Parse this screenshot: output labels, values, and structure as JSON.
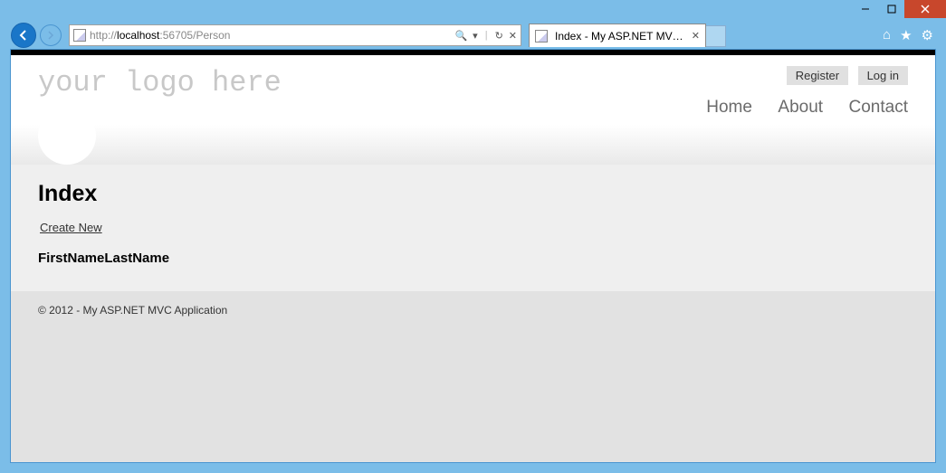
{
  "browser": {
    "url_prefix": "http://",
    "url_host": "localhost",
    "url_suffix": ":56705/Person",
    "tab_title": "Index - My ASP.NET MVC A..."
  },
  "header": {
    "logo": "your logo here",
    "auth": {
      "register": "Register",
      "login": "Log in"
    },
    "nav": {
      "home": "Home",
      "about": "About",
      "contact": "Contact"
    }
  },
  "main": {
    "heading": "Index",
    "create": "Create New",
    "columns": {
      "first": "FirstName",
      "last": "LastName"
    }
  },
  "footer": {
    "text": "© 2012 - My ASP.NET MVC Application"
  }
}
